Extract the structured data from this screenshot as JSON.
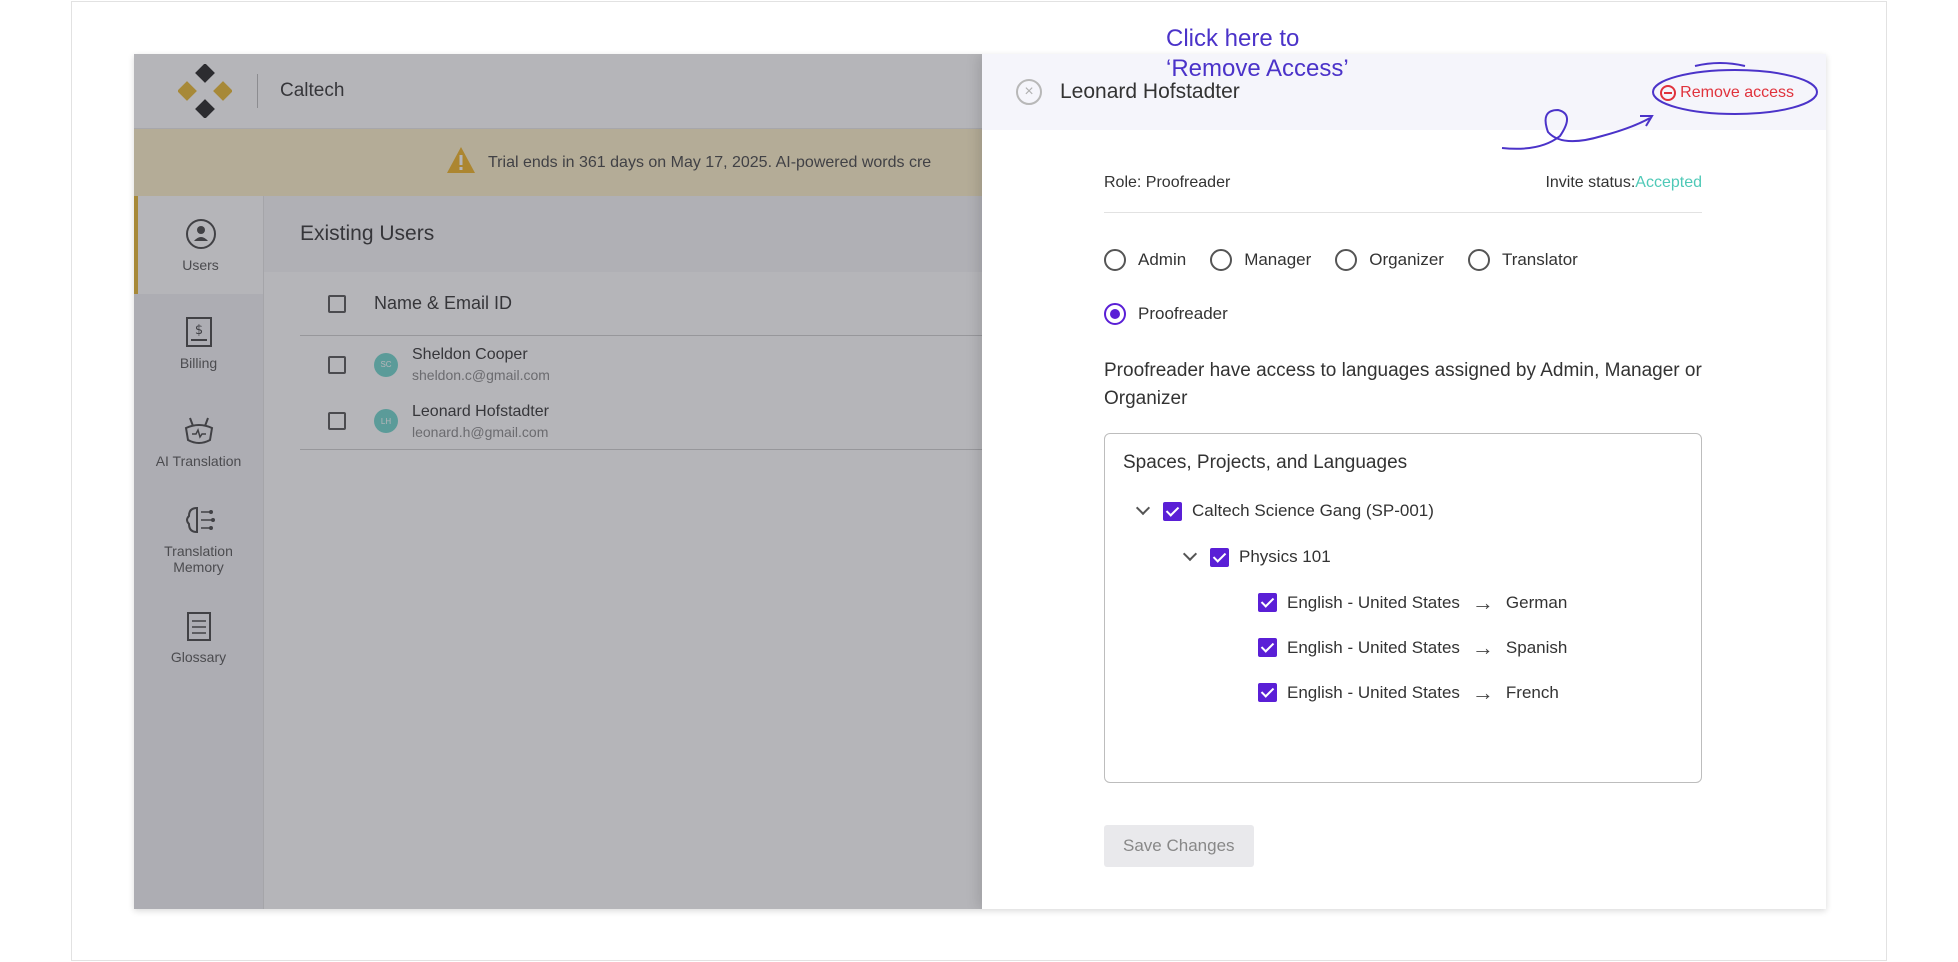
{
  "app": {
    "org_name": "Caltech"
  },
  "trial_banner": {
    "text": "Trial ends in 361 days on May 17, 2025. AI-powered words cre"
  },
  "sidebar": {
    "items": [
      {
        "label": "Users",
        "icon": "users-icon"
      },
      {
        "label": "Billing",
        "icon": "billing-icon"
      },
      {
        "label": "AI Translation",
        "icon": "ai-translation-icon"
      },
      {
        "label": "Translation Memory",
        "icon": "translation-memory-icon"
      },
      {
        "label": "Glossary",
        "icon": "glossary-icon"
      }
    ]
  },
  "main": {
    "title": "Existing Users",
    "column_header": "Name & Email ID",
    "users": [
      {
        "initials": "SC",
        "name": "Sheldon Cooper",
        "email": "sheldon.c@gmail.com"
      },
      {
        "initials": "LH",
        "name": "Leonard Hofstadter",
        "email": "leonard.h@gmail.com"
      }
    ]
  },
  "panel": {
    "title": "Leonard Hofstadter",
    "remove_label": "Remove access",
    "annotation_line1": "Click here to",
    "annotation_line2": "‘Remove Access’",
    "role_text": "Role: Proofreader",
    "invite_label": "Invite status:",
    "invite_value": "Accepted",
    "roles": [
      "Admin",
      "Manager",
      "Organizer",
      "Translator",
      "Proofreader"
    ],
    "selected_role": "Proofreader",
    "description": "Proofreader have access to languages assigned by Admin, Manager or Organizer",
    "tree_title": "Spaces, Projects, and Languages",
    "space": "Caltech Science Gang (SP-001)",
    "project": "Physics 101",
    "languages": [
      {
        "source": "English - United States",
        "target": "German"
      },
      {
        "source": "English - United States",
        "target": "Spanish"
      },
      {
        "source": "English - United States",
        "target": "French"
      }
    ],
    "save_label": "Save Changes"
  },
  "colors": {
    "accent": "#5a1fd6",
    "remove": "#e0323c",
    "accepted": "#4fc9b7",
    "trial_bg": "#fdf1c9"
  }
}
